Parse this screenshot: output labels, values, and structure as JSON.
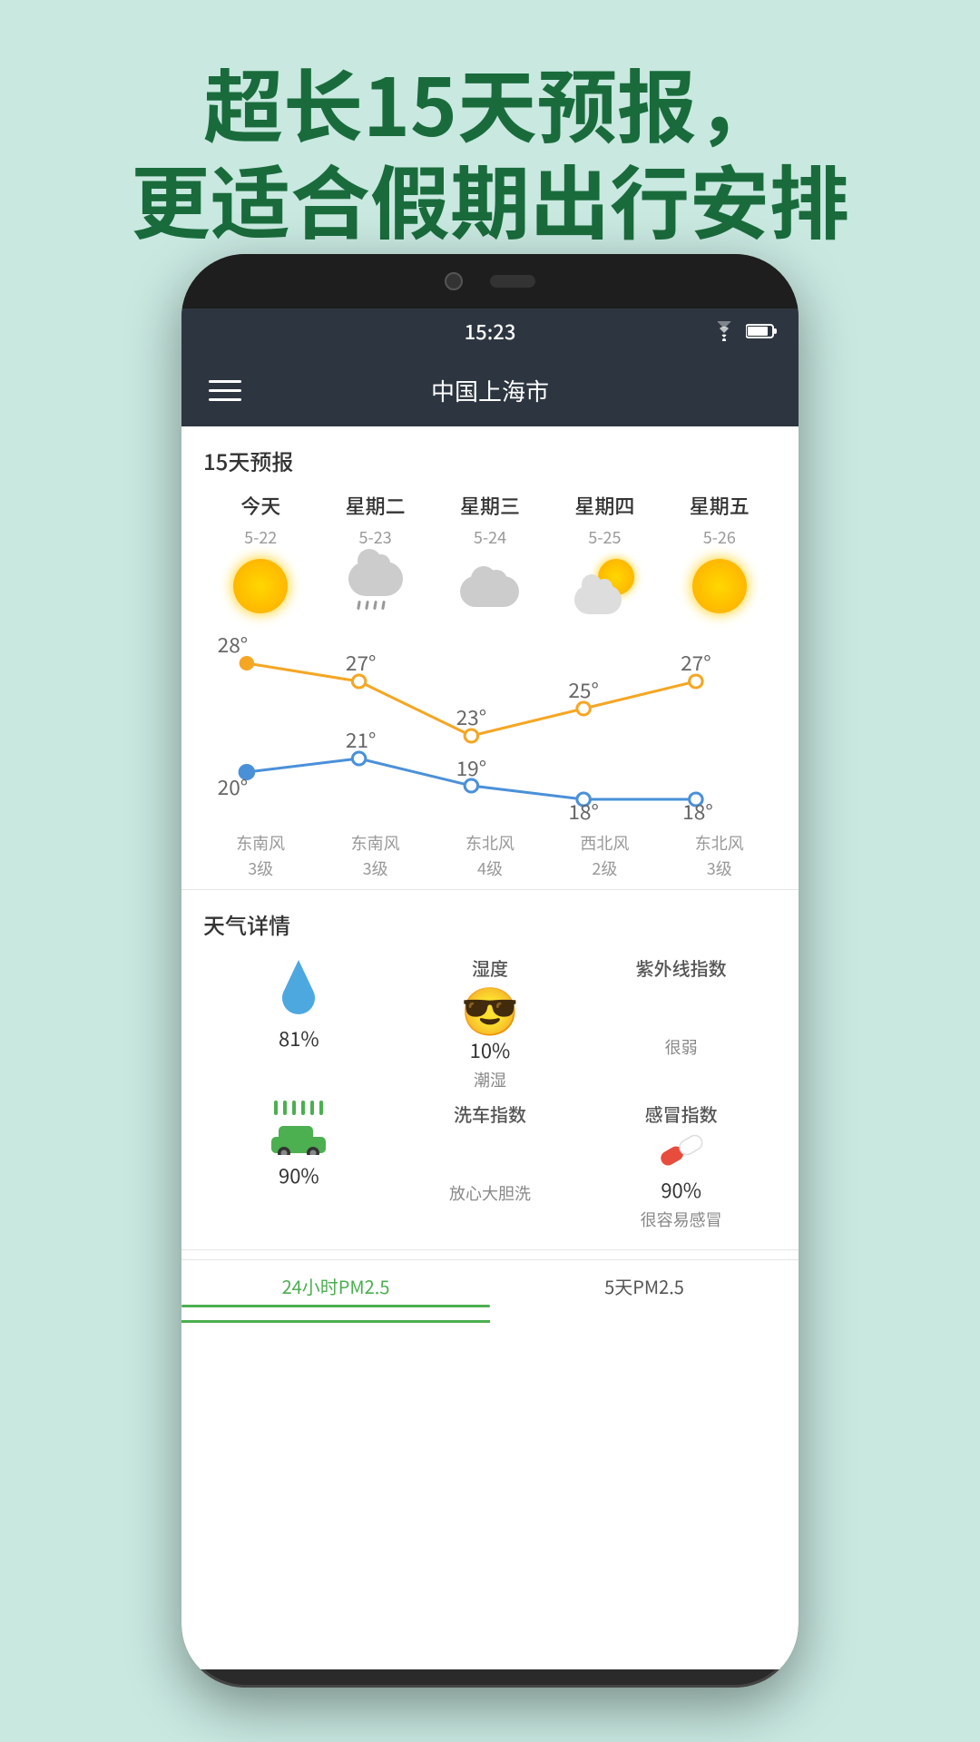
{
  "page": {
    "background": "#c8e8e0",
    "header_line1": "超长15天预报，",
    "header_line2": "更适合假期出行安排"
  },
  "status_bar": {
    "time": "15:23",
    "wifi_icon": "wifi-icon",
    "battery_icon": "battery-icon"
  },
  "navbar": {
    "menu_icon": "menu-icon",
    "city": "中国上海市"
  },
  "forecast": {
    "section_title": "15天预报",
    "days": [
      {
        "name": "今天",
        "date": "5-22",
        "weather": "sunny",
        "high": "28°",
        "low": "20°",
        "wind_dir": "东南风",
        "wind_level": "3级"
      },
      {
        "name": "星期二",
        "date": "5-23",
        "weather": "rainy",
        "high": "27°",
        "low": "21°",
        "wind_dir": "东南风",
        "wind_level": "3级"
      },
      {
        "name": "星期三",
        "date": "5-24",
        "weather": "cloudy",
        "high": "23°",
        "low": "19°",
        "wind_dir": "东北风",
        "wind_level": "4级"
      },
      {
        "name": "星期四",
        "date": "5-25",
        "weather": "partly-cloudy",
        "high": "25°",
        "low": "18°",
        "wind_dir": "西北风",
        "wind_level": "2级"
      },
      {
        "name": "星期五",
        "date": "5-26",
        "weather": "sunny",
        "high": "27°",
        "low": "18°",
        "wind_dir": "东北风",
        "wind_level": "3级"
      }
    ]
  },
  "details": {
    "section_title": "天气详情",
    "items": [
      {
        "icon": "water-drop",
        "value": "81%",
        "label": "",
        "desc": ""
      },
      {
        "icon": "uv-face",
        "value": "10%",
        "label": "湿度",
        "desc": "潮湿"
      },
      {
        "icon": "uv-face",
        "value": "",
        "label": "紫外线指数",
        "desc": "很弱"
      },
      {
        "icon": "car-wash",
        "value": "90%",
        "label": "",
        "desc": ""
      },
      {
        "icon": "pill",
        "value": "90%",
        "label": "洗车指数",
        "desc": "放心大胆洗"
      },
      {
        "icon": "pill",
        "value": "",
        "label": "感冒指数",
        "desc": "很容易感冒"
      }
    ],
    "humidity_value": "81%",
    "humidity_label": "湿度",
    "humidity_desc": "潮湿",
    "uv_value": "10%",
    "uv_label": "紫外线指数",
    "uv_desc": "很弱",
    "carwash_value": "90%",
    "carwash_label": "洗车指数",
    "carwash_desc": "放心大胆洗",
    "cold_value": "90%",
    "cold_label": "感冒指数",
    "cold_desc": "很容易感冒"
  },
  "bottom_tabs": {
    "tab1": "24小时PM2.5",
    "tab2": "5天PM2.5"
  }
}
